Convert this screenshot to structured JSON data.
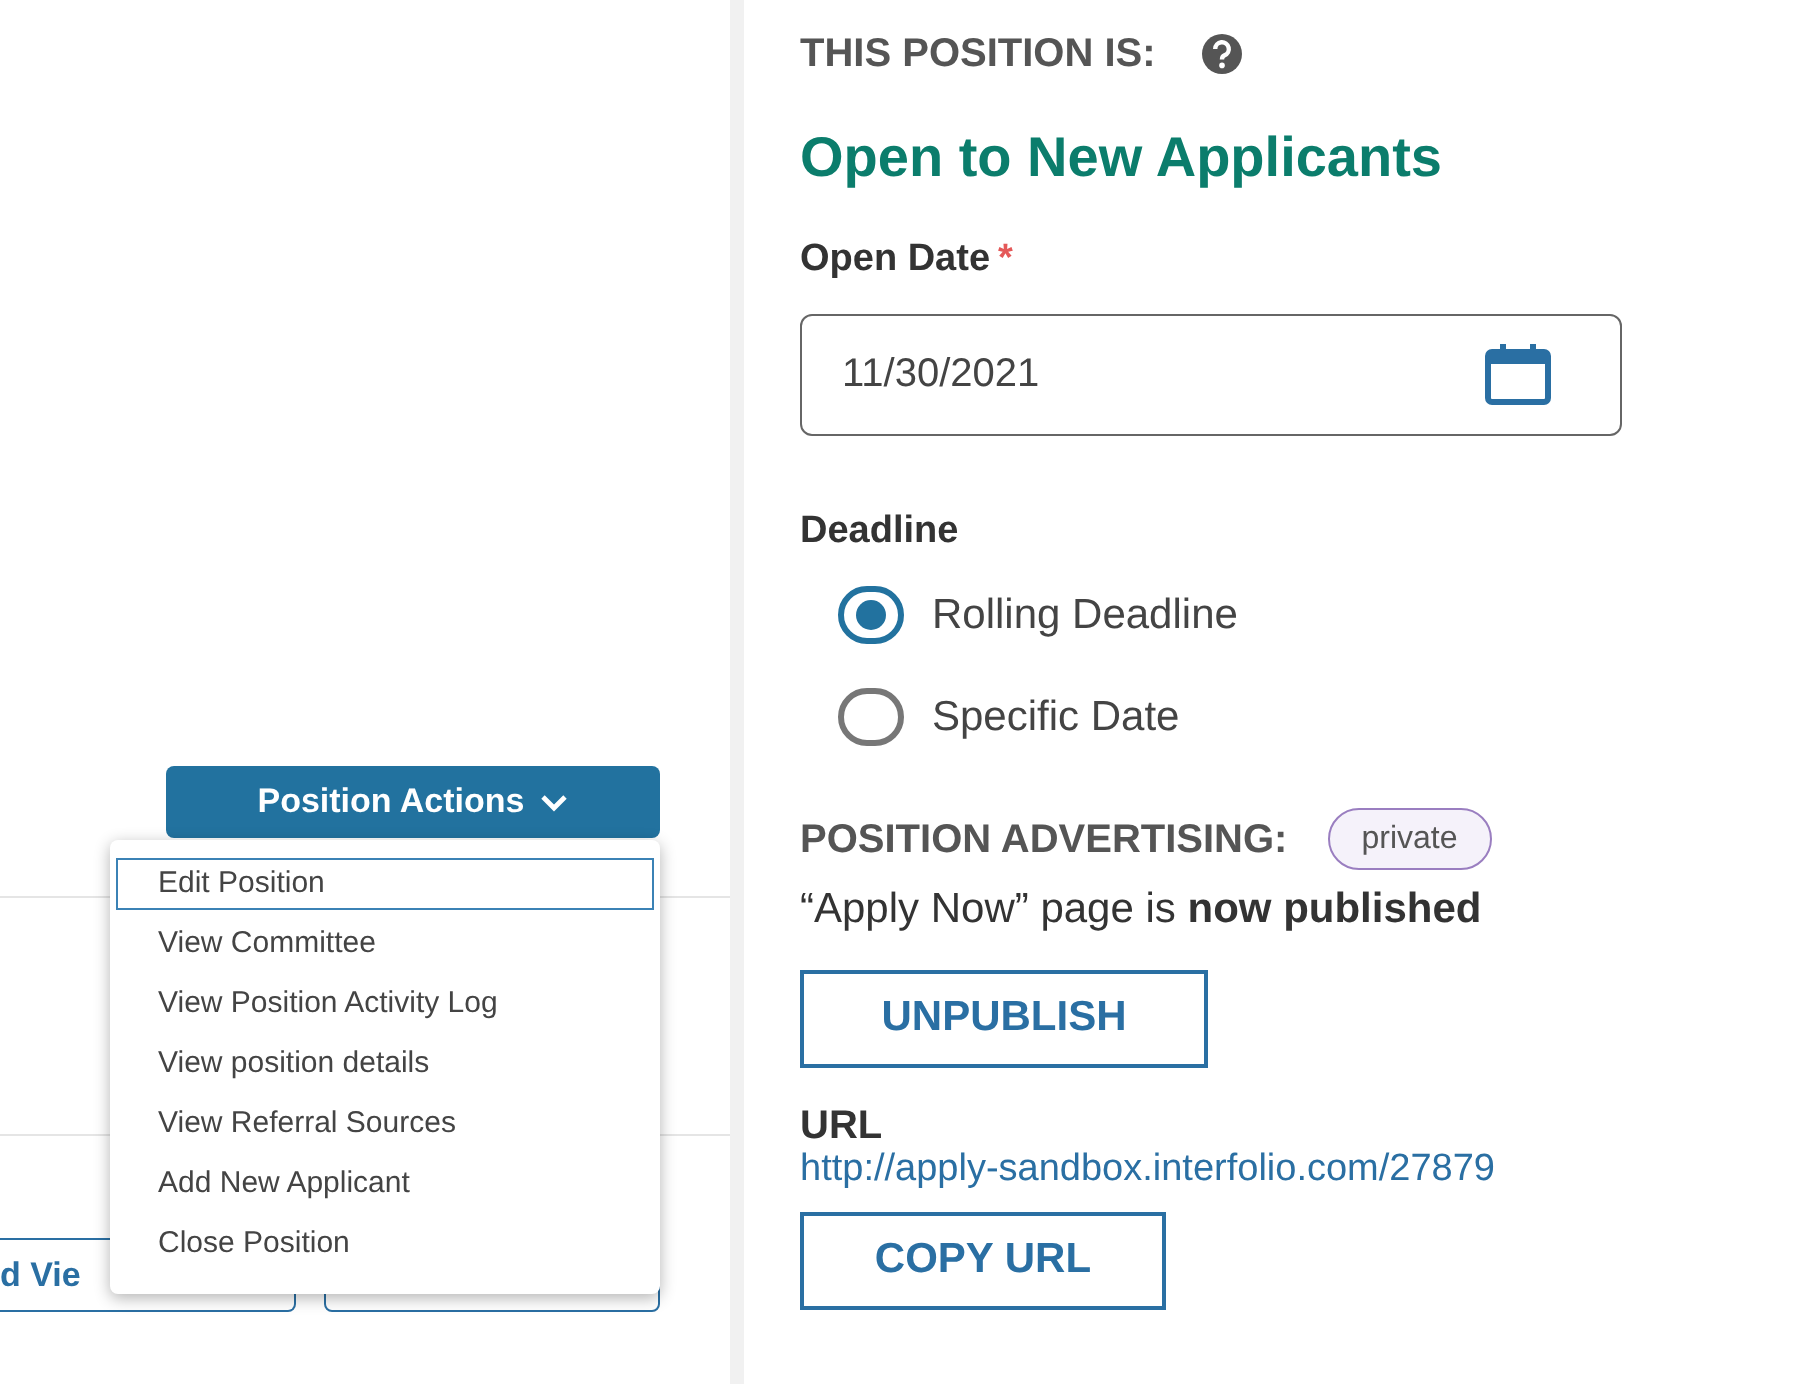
{
  "position_actions": {
    "label": "Position Actions",
    "menu": [
      {
        "label": "Edit Position",
        "selected": true
      },
      {
        "label": "View Committee",
        "selected": false
      },
      {
        "label": "View Position Activity Log",
        "selected": false
      },
      {
        "label": "View position details",
        "selected": false
      },
      {
        "label": "View Referral Sources",
        "selected": false
      },
      {
        "label": "Add New Applicant",
        "selected": false
      },
      {
        "label": "Close Position",
        "selected": false
      }
    ]
  },
  "bottom_buttons": [
    {
      "label": "d Vie"
    }
  ],
  "status": {
    "heading": "THIS POSITION IS:",
    "value": "Open to New Applicants"
  },
  "open_date": {
    "label": "Open Date",
    "required_mark": "*",
    "value": "11/30/2021"
  },
  "deadline": {
    "label": "Deadline",
    "options": [
      {
        "label": "Rolling Deadline",
        "selected": true
      },
      {
        "label": "Specific Date",
        "selected": false
      }
    ]
  },
  "advertising": {
    "heading": "POSITION ADVERTISING:",
    "badge": "private",
    "message": "“Apply Now” page is **now published**",
    "button": "UNPUBLISH"
  },
  "url": {
    "label": "URL",
    "link": "http://apply-sandbox.interfolio.com/27879",
    "button": "COPY URL"
  }
}
